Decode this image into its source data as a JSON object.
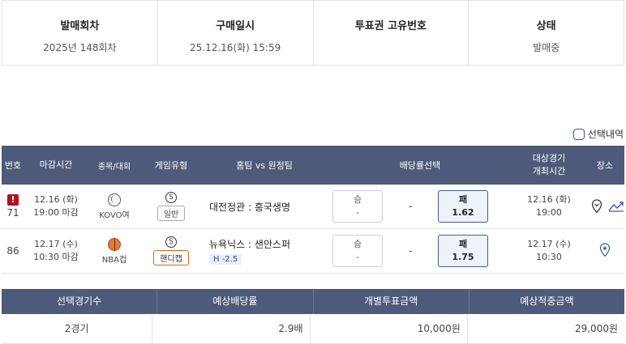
{
  "info": {
    "round_label": "발매회차",
    "round_value": "2025년 148회차",
    "purchase_label": "구매일시",
    "purchase_value": "25.12.16(화) 15:59",
    "ticket_label": "투표권 고유번호",
    "ticket_value": "",
    "status_label": "상태",
    "status_value": "발매중"
  },
  "selected_history_label": "선택내역",
  "columns": {
    "no": "번호",
    "deadline": "마감시간",
    "sport": "종목/대회",
    "game_type": "게임유형",
    "match": "홈팀 vs 원정팀",
    "odds": "배당률선택",
    "date_line1": "대상경기",
    "date_line2": "개최시간",
    "place": "장소"
  },
  "games": [
    {
      "no": "71",
      "warn": "!",
      "deadline_date": "12.16 (화)",
      "deadline_time": "19:00 마감",
      "league": "KOVO여",
      "sport_icon": "volleyball-icon",
      "s_badge": "S",
      "type": "일반",
      "match": "대전정관 : 흥국생명",
      "handicap": "",
      "win_label": "승",
      "win_value": "-",
      "draw_value": "-",
      "lose_label": "패",
      "lose_value": "1.62",
      "event_date": "12.16 (화)",
      "event_time": "19:00"
    },
    {
      "no": "86",
      "warn": "",
      "deadline_date": "12.17 (수)",
      "deadline_time": "10:30 마감",
      "league": "NBA컵",
      "sport_icon": "basketball-icon",
      "s_badge": "S",
      "type": "핸디캡",
      "match": "뉴욕닉스 : 샌안스퍼",
      "handicap": "H -2.5",
      "win_label": "승",
      "win_value": "-",
      "draw_value": "-",
      "lose_label": "패",
      "lose_value": "1.75",
      "event_date": "12.17 (수)",
      "event_time": "10:30"
    }
  ],
  "summary": {
    "count_label": "선택경기수",
    "odds_label": "예상배당률",
    "amount_label": "개별투표금액",
    "expected_label": "예상적중금액",
    "count_value": "2경기",
    "odds_value": "2.9배",
    "amount_value": "10,000원",
    "expected_value": "29,000원"
  },
  "colors": {
    "header_bg": "#4e5a79",
    "selected_border": "#3f5f92",
    "warn": "#b3121f",
    "handicap_border": "#d2691e"
  }
}
